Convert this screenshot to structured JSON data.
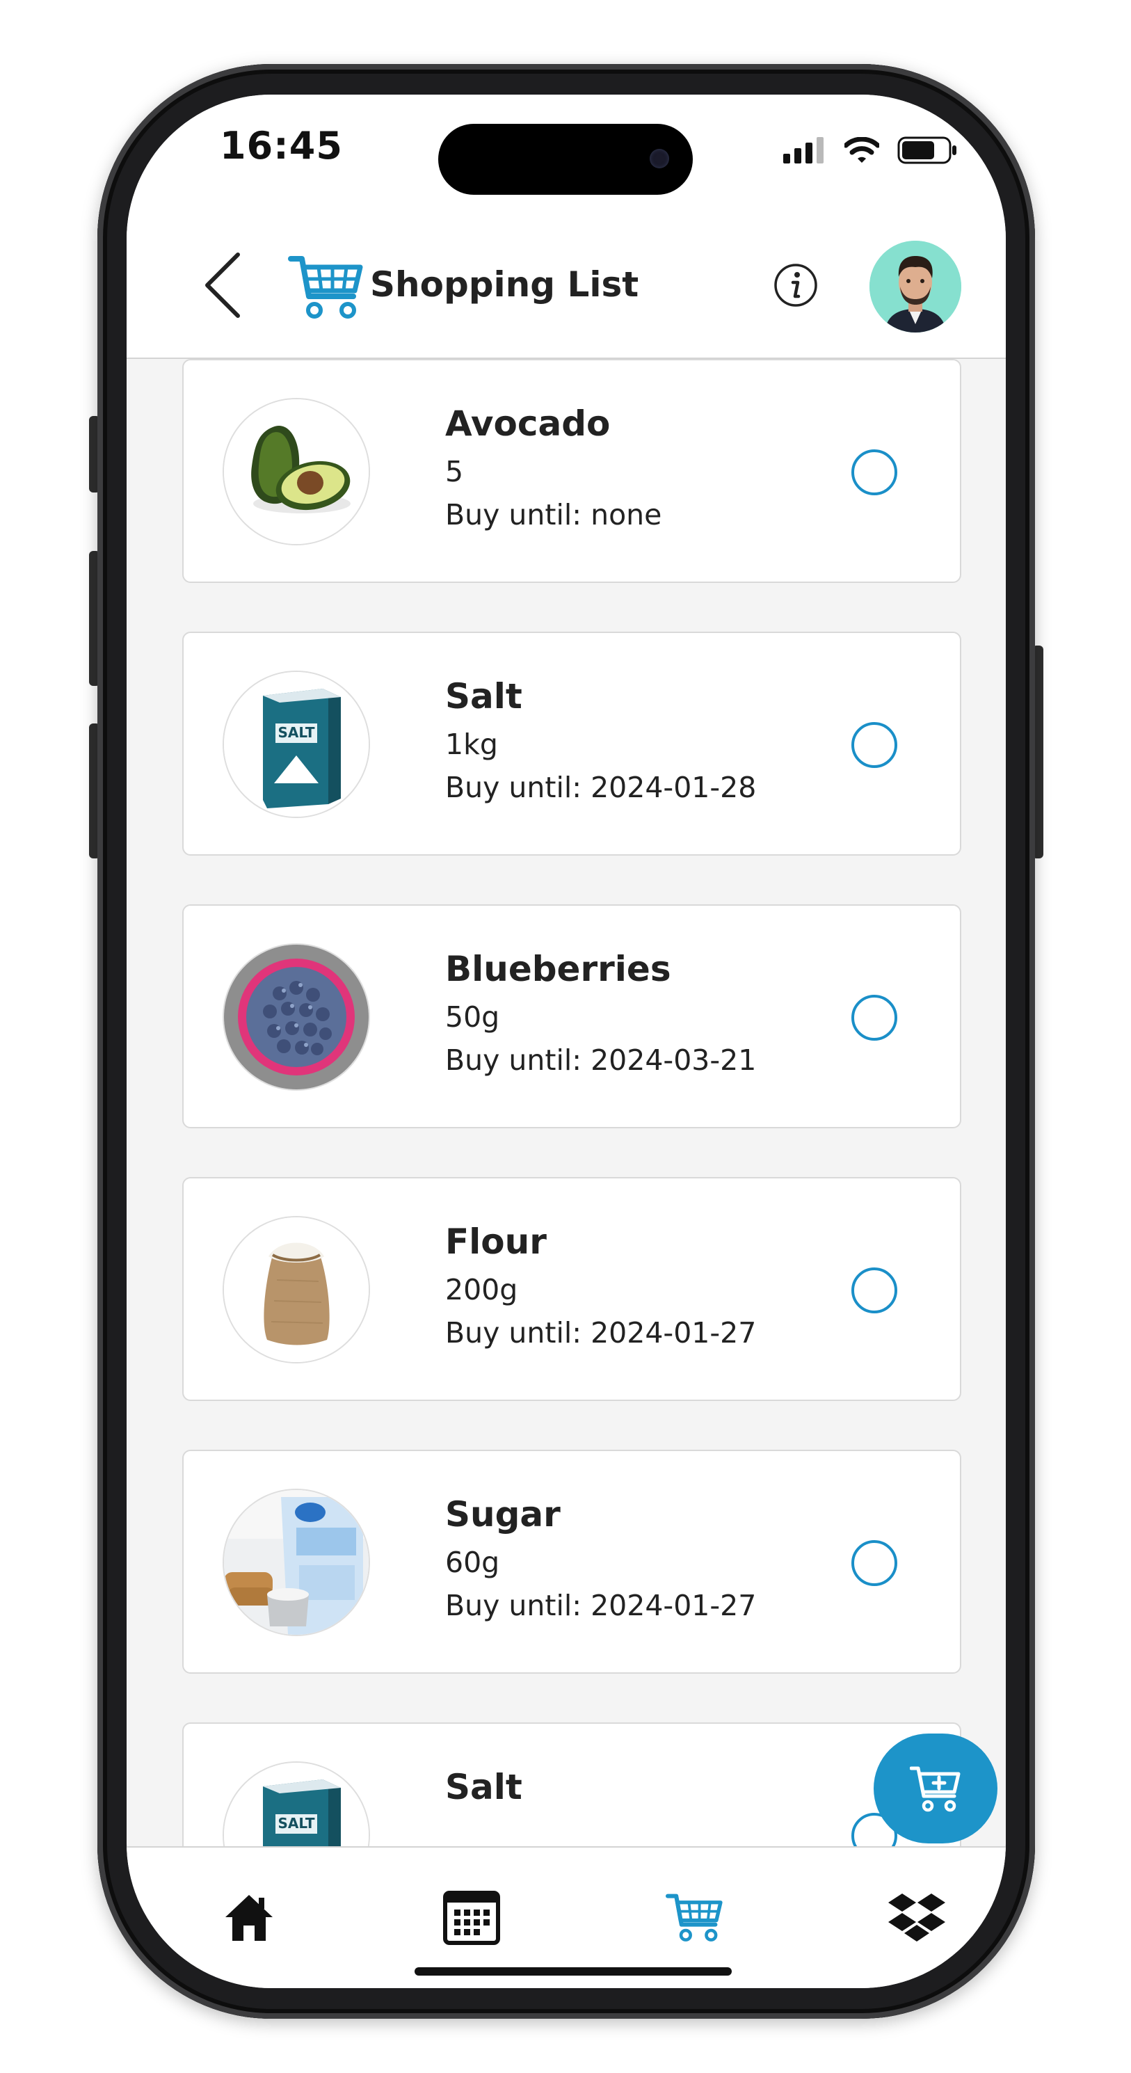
{
  "status_bar": {
    "time": "16:45"
  },
  "header": {
    "title": "Shopping List"
  },
  "items": [
    {
      "name": "Avocado",
      "quantity": "5",
      "buy_until": "Buy until: none",
      "image": "avocado",
      "checked": false
    },
    {
      "name": "Salt",
      "quantity": "1kg",
      "buy_until": "Buy until: 2024-01-28",
      "image": "salt",
      "checked": false
    },
    {
      "name": "Blueberries",
      "quantity": "50g",
      "buy_until": "Buy until: 2024-03-21",
      "image": "blueberries",
      "checked": false
    },
    {
      "name": "Flour",
      "quantity": "200g",
      "buy_until": "Buy until: 2024-01-27",
      "image": "flour",
      "checked": false
    },
    {
      "name": "Sugar",
      "quantity": "60g",
      "buy_until": "Buy until: 2024-01-27",
      "image": "sugar",
      "checked": false
    },
    {
      "name": "Salt",
      "image": "salt",
      "checked": false
    }
  ],
  "nav": [
    "home-icon",
    "calendar-icon",
    "cart-icon",
    "dropbox-icon"
  ],
  "active_nav": "cart-icon",
  "colors": {
    "accent": "#1d94c9"
  }
}
